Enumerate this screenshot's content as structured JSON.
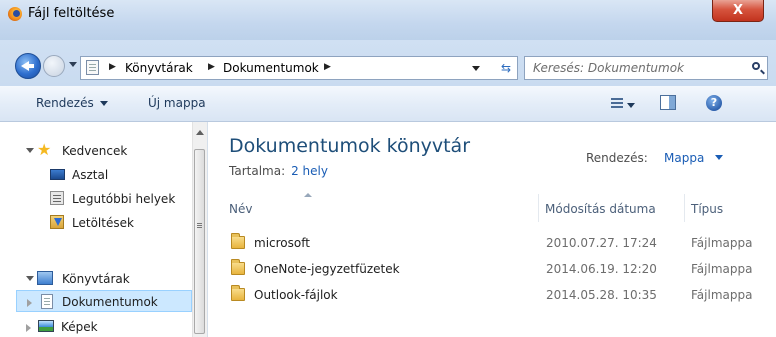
{
  "window": {
    "title": "Fájl feltöltése",
    "close_label": "X"
  },
  "address": {
    "crumbs": [
      "Könyvtárak",
      "Dokumentumok"
    ],
    "search_placeholder": "Keresés: Dokumentumok"
  },
  "toolbar": {
    "organize_label": "Rendezés",
    "new_folder_label": "Új mappa",
    "help_label": "?"
  },
  "nav": {
    "favorites_label": "Kedvencek",
    "items": [
      {
        "label": "Asztal",
        "icon": "desktop-icon"
      },
      {
        "label": "Legutóbbi helyek",
        "icon": "recent-places-icon"
      },
      {
        "label": "Letöltések",
        "icon": "downloads-icon"
      }
    ],
    "libraries_label": "Könyvtárak",
    "libraries": [
      {
        "label": "Dokumentumok",
        "icon": "documents-icon",
        "selected": true
      },
      {
        "label": "Képek",
        "icon": "pictures-icon",
        "selected": false
      }
    ]
  },
  "content": {
    "library_title": "Dokumentumok könyvtár",
    "includes_label": "Tartalma:",
    "includes_link": "2 hely",
    "arrange_label": "Rendezés:",
    "arrange_value": "Mappa",
    "columns": {
      "name": "Név",
      "date": "Módosítás dátuma",
      "type": "Típus"
    },
    "files": [
      {
        "name": "microsoft",
        "date": "2010.07.27. 17:24",
        "type": "Fájlmappa"
      },
      {
        "name": "OneNote-jegyzetfüzetek",
        "date": "2014.06.19. 12:20",
        "type": "Fájlmappa"
      },
      {
        "name": "Outlook-fájlok",
        "date": "2014.05.28. 10:35",
        "type": "Fájlmappa"
      }
    ]
  },
  "colors": {
    "accent": "#1e4e79",
    "link": "#1a5db5",
    "selection": "#cce8ff",
    "close_button": "#c2331e"
  }
}
